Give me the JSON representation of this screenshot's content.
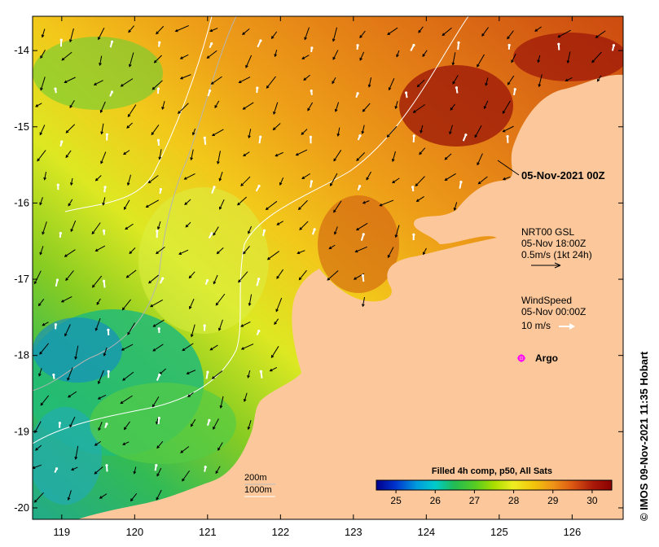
{
  "map": {
    "colorbar_title": "Filled 4h comp, p50, All Sats",
    "colorbar_ticks": [
      "25",
      "26",
      "27",
      "28",
      "29",
      "30"
    ],
    "colorbar_range": [
      24.5,
      30.5
    ],
    "palette": [
      "#00008b",
      "#0033cc",
      "#0099dd",
      "#00cccc",
      "#22bb55",
      "#55cc22",
      "#aadd00",
      "#eeee22",
      "#f2c40c",
      "#ee9418",
      "#dd5a12",
      "#aa1a0a",
      "#8b0000"
    ],
    "land_color": "#fcc89b",
    "x_ticks": [
      "119",
      "120",
      "121",
      "122",
      "123",
      "124",
      "125",
      "126"
    ],
    "y_ticks": [
      "-14",
      "-15",
      "-16",
      "-17",
      "-18",
      "-19",
      "-20"
    ],
    "x_range": [
      118.6,
      126.7
    ],
    "y_range": [
      -20.15,
      -13.55
    ],
    "date_label": "05-Nov-2021 00Z",
    "nrt": {
      "line1": "NRT00 GSL",
      "line2": "05-Nov 18:00Z",
      "line3": "0.5m/s (1kt 24h)"
    },
    "wind": {
      "line1": "WindSpeed",
      "line2": "05-Nov 00:00Z",
      "line3": "10 m/s"
    },
    "argo_label": "Argo",
    "isobaths": {
      "line1": "200m",
      "line2": "1000m"
    },
    "credit": "© IMOS 09-Nov-2021 11:35 Hobart",
    "colors": {
      "argo": "#ff00ff",
      "isobath_200": "#bbbbbb",
      "isobath_1000": "#ffffff",
      "wind_arrow": "#ffffff",
      "current_arrow": "#000000"
    }
  }
}
